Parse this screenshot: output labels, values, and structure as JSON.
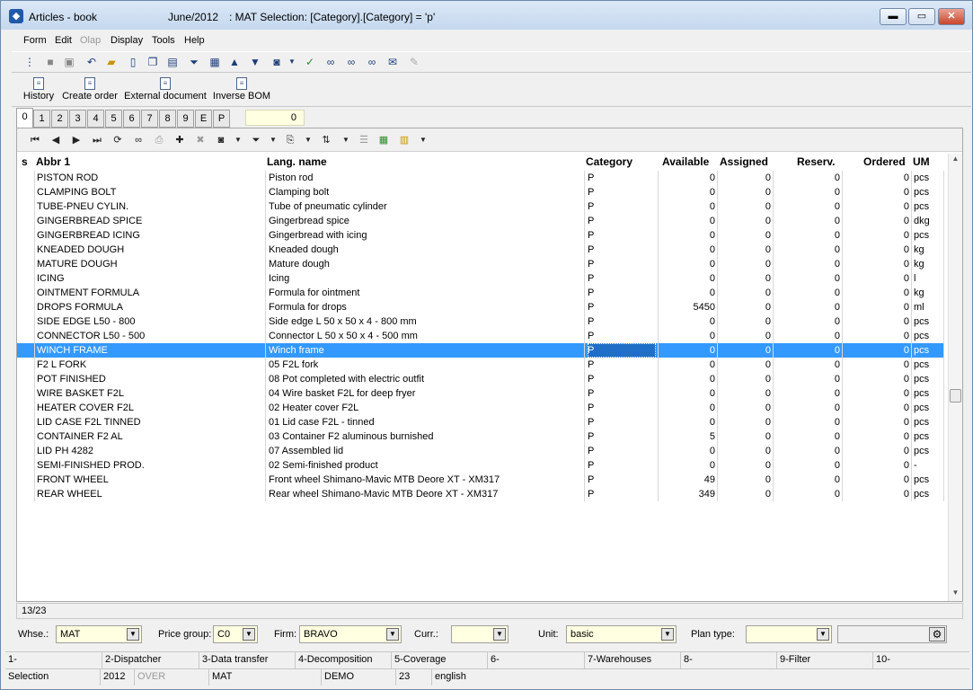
{
  "window": {
    "title": "Articles - book",
    "period": "June/2012",
    "selection": ": MAT Selection: [Category].[Category] = 'p'",
    "min_label": "▬",
    "max_label": "▭",
    "close_label": "✕"
  },
  "menu": {
    "form": "Form",
    "edit": "Edit",
    "olap": "Olap",
    "display": "Display",
    "tools": "Tools",
    "help": "Help"
  },
  "actions": {
    "history": "History",
    "create_order": "Create order",
    "external_document": "External document",
    "inverse_bom": "Inverse BOM"
  },
  "tabs": [
    "0",
    "1",
    "2",
    "3",
    "4",
    "5",
    "6",
    "7",
    "8",
    "9",
    "E",
    "P"
  ],
  "counter": "0",
  "columns": {
    "s": "s",
    "abbr": "Abbr 1",
    "lang_name": "Lang. name",
    "category": "Category",
    "available": "Available",
    "assigned": "Assigned",
    "reserv": "Reserv.",
    "ordered": "Ordered",
    "um": "UM"
  },
  "rows": [
    {
      "abbr": "PISTON ROD",
      "name": "Piston rod",
      "cat": "P",
      "avail": "0",
      "assigned": "0",
      "reserv": "0",
      "ordered": "0",
      "um": "pcs"
    },
    {
      "abbr": "CLAMPING BOLT",
      "name": "Clamping bolt",
      "cat": "P",
      "avail": "0",
      "assigned": "0",
      "reserv": "0",
      "ordered": "0",
      "um": "pcs"
    },
    {
      "abbr": "TUBE-PNEU CYLIN.",
      "name": "Tube of pneumatic cylinder",
      "cat": "P",
      "avail": "0",
      "assigned": "0",
      "reserv": "0",
      "ordered": "0",
      "um": "pcs"
    },
    {
      "abbr": "GINGERBREAD SPICE",
      "name": "Gingerbread spice",
      "cat": "P",
      "avail": "0",
      "assigned": "0",
      "reserv": "0",
      "ordered": "0",
      "um": "dkg"
    },
    {
      "abbr": "GINGERBREAD ICING",
      "name": "Gingerbread with icing",
      "cat": "P",
      "avail": "0",
      "assigned": "0",
      "reserv": "0",
      "ordered": "0",
      "um": "pcs"
    },
    {
      "abbr": "KNEADED DOUGH",
      "name": "Kneaded dough",
      "cat": "P",
      "avail": "0",
      "assigned": "0",
      "reserv": "0",
      "ordered": "0",
      "um": "kg"
    },
    {
      "abbr": "MATURE DOUGH",
      "name": "Mature dough",
      "cat": "P",
      "avail": "0",
      "assigned": "0",
      "reserv": "0",
      "ordered": "0",
      "um": "kg"
    },
    {
      "abbr": "ICING",
      "name": "Icing",
      "cat": "P",
      "avail": "0",
      "assigned": "0",
      "reserv": "0",
      "ordered": "0",
      "um": "l"
    },
    {
      "abbr": "OINTMENT FORMULA",
      "name": "Formula for ointment",
      "cat": "P",
      "avail": "0",
      "assigned": "0",
      "reserv": "0",
      "ordered": "0",
      "um": "kg"
    },
    {
      "abbr": "DROPS FORMULA",
      "name": "Formula for drops",
      "cat": "P",
      "avail": "5450",
      "assigned": "0",
      "reserv": "0",
      "ordered": "0",
      "um": "ml"
    },
    {
      "abbr": "SIDE EDGE L50 - 800",
      "name": "Side edge L 50 x 50 x 4 - 800 mm",
      "cat": "P",
      "avail": "0",
      "assigned": "0",
      "reserv": "0",
      "ordered": "0",
      "um": "pcs"
    },
    {
      "abbr": "CONNECTOR L50 - 500",
      "name": "Connector L 50 x 50 x 4 - 500 mm",
      "cat": "P",
      "avail": "0",
      "assigned": "0",
      "reserv": "0",
      "ordered": "0",
      "um": "pcs"
    },
    {
      "abbr": "WINCH FRAME",
      "name": "Winch frame",
      "cat": "P",
      "avail": "0",
      "assigned": "0",
      "reserv": "0",
      "ordered": "0",
      "um": "pcs",
      "selected": true
    },
    {
      "abbr": "F2 L FORK",
      "name": "05 F2L fork",
      "cat": "P",
      "avail": "0",
      "assigned": "0",
      "reserv": "0",
      "ordered": "0",
      "um": "pcs"
    },
    {
      "abbr": "POT FINISHED",
      "name": "08 Pot completed with electric outfit",
      "cat": "P",
      "avail": "0",
      "assigned": "0",
      "reserv": "0",
      "ordered": "0",
      "um": "pcs"
    },
    {
      "abbr": "WIRE BASKET F2L",
      "name": "04 Wire basket F2L for deep fryer",
      "cat": "P",
      "avail": "0",
      "assigned": "0",
      "reserv": "0",
      "ordered": "0",
      "um": "pcs"
    },
    {
      "abbr": "HEATER COVER F2L",
      "name": "02 Heater cover F2L",
      "cat": "P",
      "avail": "0",
      "assigned": "0",
      "reserv": "0",
      "ordered": "0",
      "um": "pcs"
    },
    {
      "abbr": "LID CASE F2L TINNED",
      "name": "01 Lid case F2L - tinned",
      "cat": "P",
      "avail": "0",
      "assigned": "0",
      "reserv": "0",
      "ordered": "0",
      "um": "pcs"
    },
    {
      "abbr": "CONTAINER F2 AL",
      "name": "03 Container F2 aluminous burnished",
      "cat": "P",
      "avail": "5",
      "assigned": "0",
      "reserv": "0",
      "ordered": "0",
      "um": "pcs"
    },
    {
      "abbr": "LID PH 4282",
      "name": "07 Assembled lid",
      "cat": "P",
      "avail": "0",
      "assigned": "0",
      "reserv": "0",
      "ordered": "0",
      "um": "pcs"
    },
    {
      "abbr": "SEMI-FINISHED PROD.",
      "name": "02 Semi-finished product",
      "cat": "P",
      "avail": "0",
      "assigned": "0",
      "reserv": "0",
      "ordered": "0",
      "um": "-"
    },
    {
      "abbr": "FRONT WHEEL",
      "name": "Front wheel Shimano-Mavic MTB Deore XT - XM317",
      "cat": "P",
      "avail": "49",
      "assigned": "0",
      "reserv": "0",
      "ordered": "0",
      "um": "pcs"
    },
    {
      "abbr": "REAR WHEEL",
      "name": "Rear wheel Shimano-Mavic MTB Deore XT - XM317",
      "cat": "P",
      "avail": "349",
      "assigned": "0",
      "reserv": "0",
      "ordered": "0",
      "um": "pcs"
    }
  ],
  "record_position": "13/23",
  "filters": {
    "whse_label": "Whse.:",
    "whse_value": "MAT",
    "price_group_label": "Price group:",
    "price_group_value": "C0",
    "firm_label": "Firm:",
    "firm_value": "BRAVO",
    "curr_label": "Curr.:",
    "curr_value": "",
    "unit_label": "Unit:",
    "unit_value": "basic",
    "plan_type_label": "Plan type:",
    "plan_type_value": ""
  },
  "function_keys": [
    "1-",
    "2-Dispatcher",
    "3-Data transfer",
    "4-Decomposition",
    "5-Coverage",
    "6-",
    "7-Warehouses",
    "8-",
    "9-Filter",
    "10-"
  ],
  "status": {
    "mode": "Selection",
    "year": "2012",
    "over": "OVER",
    "warehouse": "MAT",
    "db": "DEMO",
    "number": "23",
    "language": "english"
  }
}
